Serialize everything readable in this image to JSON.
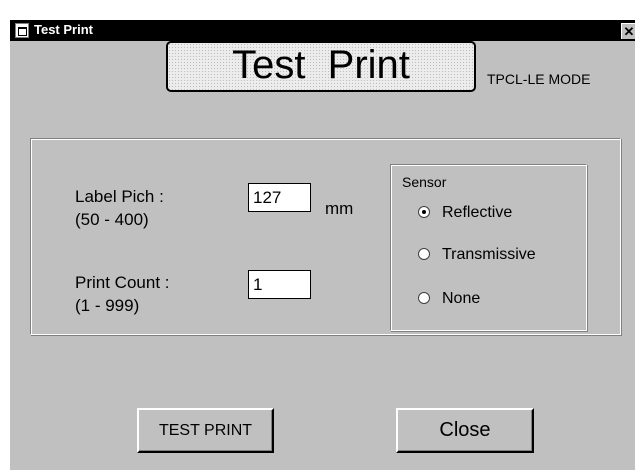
{
  "window": {
    "title": "Test Print",
    "close_glyph": "✕"
  },
  "banner": {
    "title": "Test  Print",
    "mode": "TPCL-LE MODE"
  },
  "form": {
    "label_pitch": {
      "label": "Label Pich :",
      "range": "(50 - 400)",
      "value": "127",
      "unit": "mm"
    },
    "print_count": {
      "label": "Print Count :",
      "range": "(1 - 999)",
      "value": "1"
    }
  },
  "sensor": {
    "legend": "Sensor",
    "options": [
      {
        "label": "Reflective",
        "checked": true
      },
      {
        "label": "Transmissive",
        "checked": false
      },
      {
        "label": "None",
        "checked": false
      }
    ]
  },
  "buttons": {
    "test_print": "TEST PRINT",
    "close": "Close"
  },
  "icons": {
    "title_icon": "printer-app-icon",
    "close_icon": "close-icon",
    "radio_icon": "radio-icon"
  }
}
